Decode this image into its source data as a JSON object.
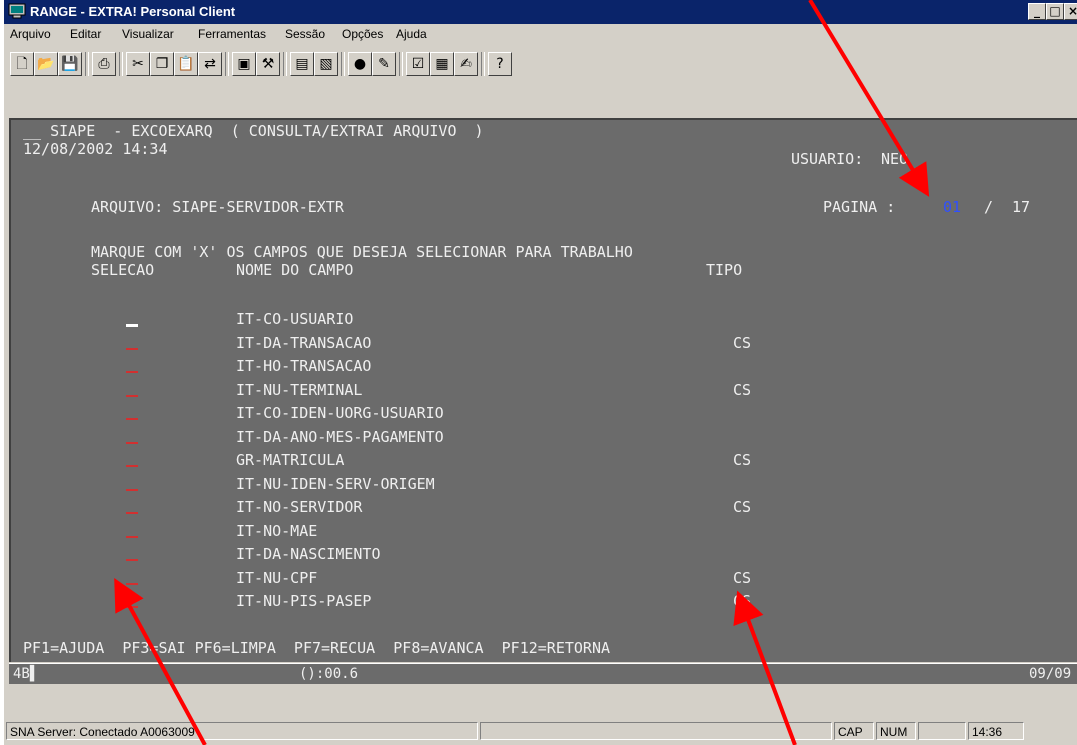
{
  "window": {
    "title": "RANGE - EXTRA! Personal Client"
  },
  "menu": [
    "Arquivo",
    "Editar",
    "Visualizar",
    "Ferramentas",
    "Sessão",
    "Opções",
    "Ajuda"
  ],
  "terminal": {
    "header_line": "__ SIAPE  - EXCOEXARQ  ( CONSULTA/EXTRAI ARQUIVO  )",
    "datetime": "12/08/2002 14:34",
    "usuario_label": "USUARIO:",
    "usuario_value": "NEO",
    "arquivo_line": "ARQUIVO: SIAPE-SERVIDOR-EXTR",
    "pagina_label": "PAGINA :",
    "pagina_current": "01",
    "pagina_sep": "/",
    "pagina_total": "17",
    "instruction": "MARQUE COM 'X' OS CAMPOS QUE DESEJA SELECIONAR PARA TRABALHO",
    "col_selecao": "SELECAO",
    "col_nome": "NOME DO CAMPO",
    "col_tipo": "TIPO",
    "fields": [
      {
        "name": "IT-CO-USUARIO",
        "tipo": ""
      },
      {
        "name": "IT-DA-TRANSACAO",
        "tipo": "CS"
      },
      {
        "name": "IT-HO-TRANSACAO",
        "tipo": ""
      },
      {
        "name": "IT-NU-TERMINAL",
        "tipo": "CS"
      },
      {
        "name": "IT-CO-IDEN-UORG-USUARIO",
        "tipo": ""
      },
      {
        "name": "IT-DA-ANO-MES-PAGAMENTO",
        "tipo": ""
      },
      {
        "name": "GR-MATRICULA",
        "tipo": "CS"
      },
      {
        "name": "IT-NU-IDEN-SERV-ORIGEM",
        "tipo": ""
      },
      {
        "name": "IT-NO-SERVIDOR",
        "tipo": "CS"
      },
      {
        "name": "IT-NO-MAE",
        "tipo": ""
      },
      {
        "name": "IT-DA-NASCIMENTO",
        "tipo": ""
      },
      {
        "name": "IT-NU-CPF",
        "tipo": "CS"
      },
      {
        "name": "IT-NU-PIS-PASEP",
        "tipo": "CS"
      }
    ],
    "function_keys": "PF1=AJUDA  PF3=SAI PF6=LIMPA  PF7=RECUA  PF8=AVANCA  PF12=RETORNA"
  },
  "oia": {
    "left": "4B▌",
    "middle": "():00.6",
    "right": "09/09"
  },
  "statusbar": {
    "connection": "SNA Server: Conectado A0063009",
    "cap": "CAP",
    "num": "NUM",
    "time": "14:36"
  }
}
